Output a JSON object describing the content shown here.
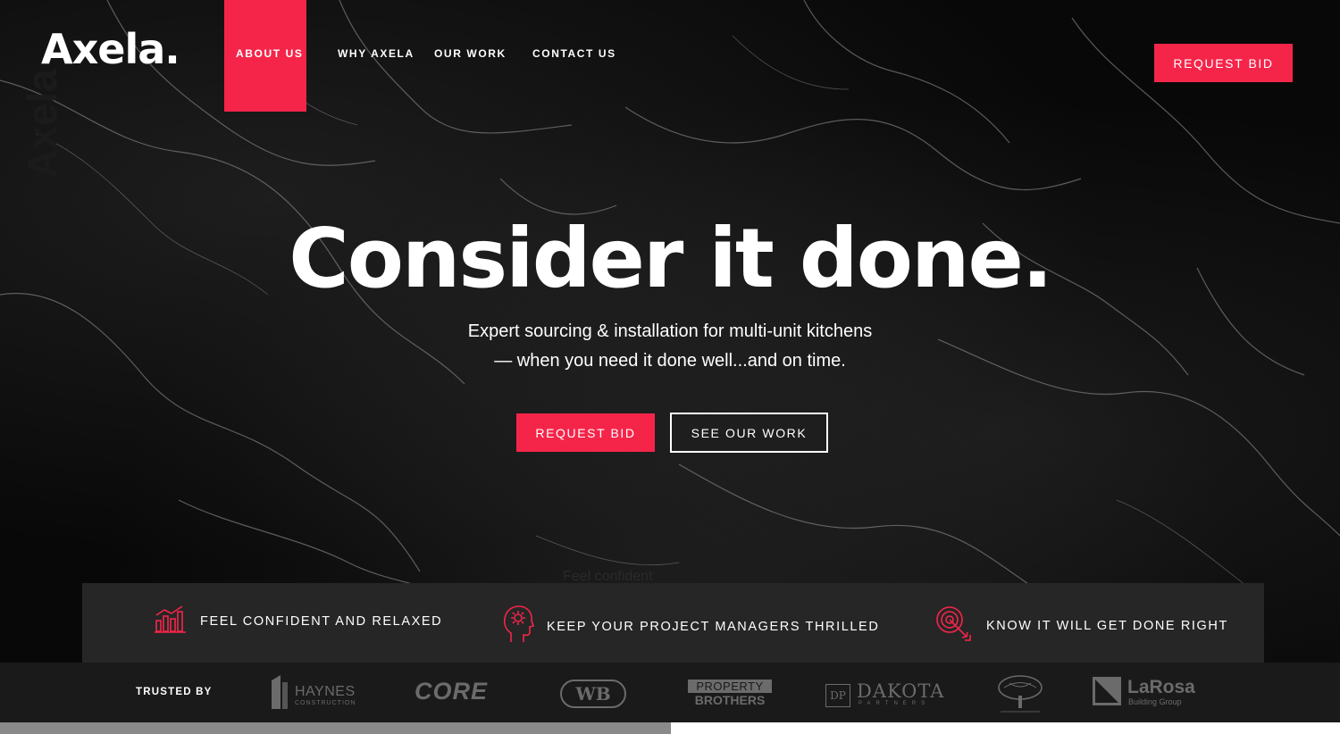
{
  "brand": {
    "logo_text": "Axela.",
    "watermark_text": "Axela"
  },
  "nav": {
    "items": [
      {
        "label": "ABOUT US",
        "active": true
      },
      {
        "label": "WHY AXELA",
        "active": false
      },
      {
        "label": "OUR WORK",
        "active": false
      },
      {
        "label": "CONTACT US",
        "active": false
      }
    ],
    "cta_label": "REQUEST BID"
  },
  "hero": {
    "headline": "Consider it done.",
    "subline_1": "Expert sourcing & installation for multi-unit kitchens",
    "subline_2": "— when you need it done well...and on time.",
    "primary_button": "REQUEST BID",
    "secondary_button": "SEE OUR WORK",
    "ghost_text": "Feel confident"
  },
  "features": [
    {
      "icon": "bar-chart-icon",
      "label": "FEEL CONFIDENT AND RELAXED"
    },
    {
      "icon": "head-idea-icon",
      "label": "KEEP YOUR PROJECT MANAGERS THRILLED"
    },
    {
      "icon": "target-arrow-icon",
      "label": "KNOW IT WILL GET DONE RIGHT"
    }
  ],
  "trusted": {
    "label": "TRUSTED BY",
    "logos": [
      {
        "name": "HAYNES",
        "sub": "CONSTRUCTION"
      },
      {
        "name": "CORE",
        "sub": ""
      },
      {
        "name": "WB",
        "sub": ""
      },
      {
        "name": "PROPERTY",
        "sub": "BROTHERS"
      },
      {
        "name": "DAKOTA",
        "sub": "PARTNERS"
      },
      {
        "name": "",
        "sub": ""
      },
      {
        "name": "LaRosa",
        "sub": "Building Group"
      }
    ]
  },
  "colors": {
    "accent": "#f5254a",
    "feature_bar": "#262626",
    "trusted_bar": "#1a1a1a"
  }
}
